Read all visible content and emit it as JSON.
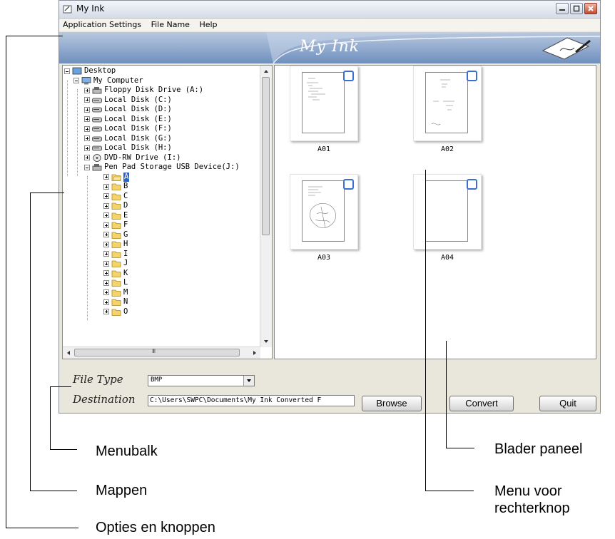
{
  "window": {
    "title": "My Ink"
  },
  "menu": [
    "Application Settings",
    "File Name",
    "Help"
  ],
  "banner": {
    "title": "My Ink"
  },
  "tree": {
    "items": [
      {
        "label": "Desktop",
        "icon": "desktop-icon"
      },
      {
        "label": "My Computer",
        "icon": "computer-icon"
      },
      {
        "label": "Floppy Disk Drive (A:)",
        "icon": "floppy-drive-icon"
      },
      {
        "label": "Local Disk (C:)",
        "icon": "hard-disk-icon"
      },
      {
        "label": "Local Disk (D:)",
        "icon": "hard-disk-icon"
      },
      {
        "label": "Local Disk (E:)",
        "icon": "hard-disk-icon"
      },
      {
        "label": "Local Disk (F:)",
        "icon": "hard-disk-icon"
      },
      {
        "label": "Local Disk (G:)",
        "icon": "hard-disk-icon"
      },
      {
        "label": "Local Disk (H:)",
        "icon": "hard-disk-icon"
      },
      {
        "label": "DVD-RW Drive (I:)",
        "icon": "dvd-drive-icon"
      },
      {
        "label": "Pen Pad Storage USB Device(J:)",
        "icon": "usb-drive-icon"
      },
      {
        "label": "A",
        "icon": "folder-open-icon",
        "selected": true
      },
      {
        "label": "B",
        "icon": "folder-icon"
      },
      {
        "label": "C",
        "icon": "folder-icon"
      },
      {
        "label": "D",
        "icon": "folder-icon"
      },
      {
        "label": "E",
        "icon": "folder-icon"
      },
      {
        "label": "F",
        "icon": "folder-icon"
      },
      {
        "label": "G",
        "icon": "folder-icon"
      },
      {
        "label": "H",
        "icon": "folder-icon"
      },
      {
        "label": "I",
        "icon": "folder-icon"
      },
      {
        "label": "J",
        "icon": "folder-icon"
      },
      {
        "label": "K",
        "icon": "folder-icon"
      },
      {
        "label": "L",
        "icon": "folder-icon"
      },
      {
        "label": "M",
        "icon": "folder-icon"
      },
      {
        "label": "N",
        "icon": "folder-icon"
      },
      {
        "label": "O",
        "icon": "folder-icon"
      }
    ],
    "hscroll_grip": "III"
  },
  "thumbnails": [
    "A01",
    "A02",
    "A03",
    "A04"
  ],
  "options": {
    "file_type_label": "File Type",
    "file_type_value": "BMP",
    "destination_label": "Destination",
    "destination_value": "C:\\Users\\SWPC\\Documents\\My Ink Converted F"
  },
  "buttons": {
    "browse": "Browse",
    "convert": "Convert",
    "quit": "Quit"
  },
  "callouts": {
    "menubar": "Menubalk",
    "folders": "Mappen",
    "options": "Opties en knoppen",
    "browse_panel": "Blader paneel",
    "context_menu_line1": "Menu voor",
    "context_menu_line2": "rechterknop"
  },
  "colors": {
    "banner": "#6f8fbd",
    "selection": "#3163c5",
    "checkbox": "#3a6fd0"
  }
}
